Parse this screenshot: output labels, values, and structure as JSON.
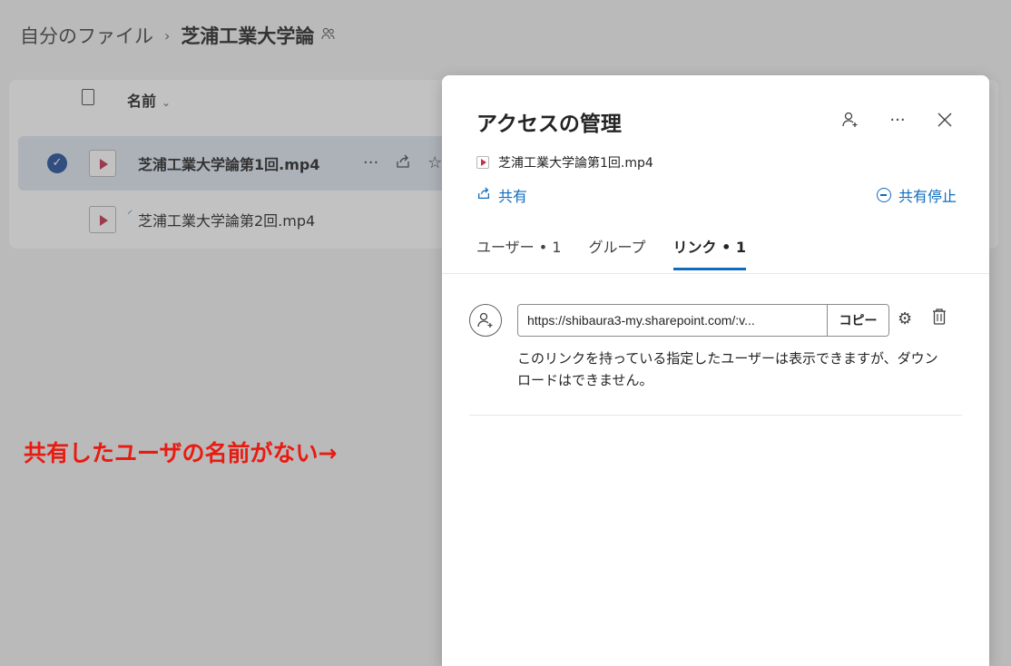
{
  "breadcrumb": {
    "root": "自分のファイル",
    "separator": "›",
    "current": "芝浦工業大学論",
    "shared_icon": "people-icon"
  },
  "file_list": {
    "header_name": "名前",
    "rows": [
      {
        "name": "芝浦工業大学論第1回.mp4",
        "selected": true
      },
      {
        "name": "芝浦工業大学論第2回.mp4",
        "selected": false
      }
    ],
    "row_actions": [
      "more-icon",
      "share-icon",
      "star-icon"
    ]
  },
  "annotation": {
    "text": "共有したユーザの名前がない→",
    "color": "#e81b12"
  },
  "panel": {
    "title": "アクセスの管理",
    "file_name": "芝浦工業大学論第1回.mp4",
    "share_label": "共有",
    "stop_share_label": "共有停止",
    "tabs": [
      {
        "label": "ユーザー • 1",
        "active": false
      },
      {
        "label": "グループ",
        "active": false
      },
      {
        "label": "リンク • 1",
        "active": true
      }
    ],
    "link": {
      "url": "https://shibaura3-my.sharepoint.com/:v...",
      "copy_label": "コピー",
      "description": "このリンクを持っている指定したユーザーは表示できますが、ダウンロードはできません。"
    }
  },
  "colors": {
    "accent": "#0f6cbd",
    "selected_row": "#dfe7f1",
    "video_icon": "#c4314b"
  }
}
